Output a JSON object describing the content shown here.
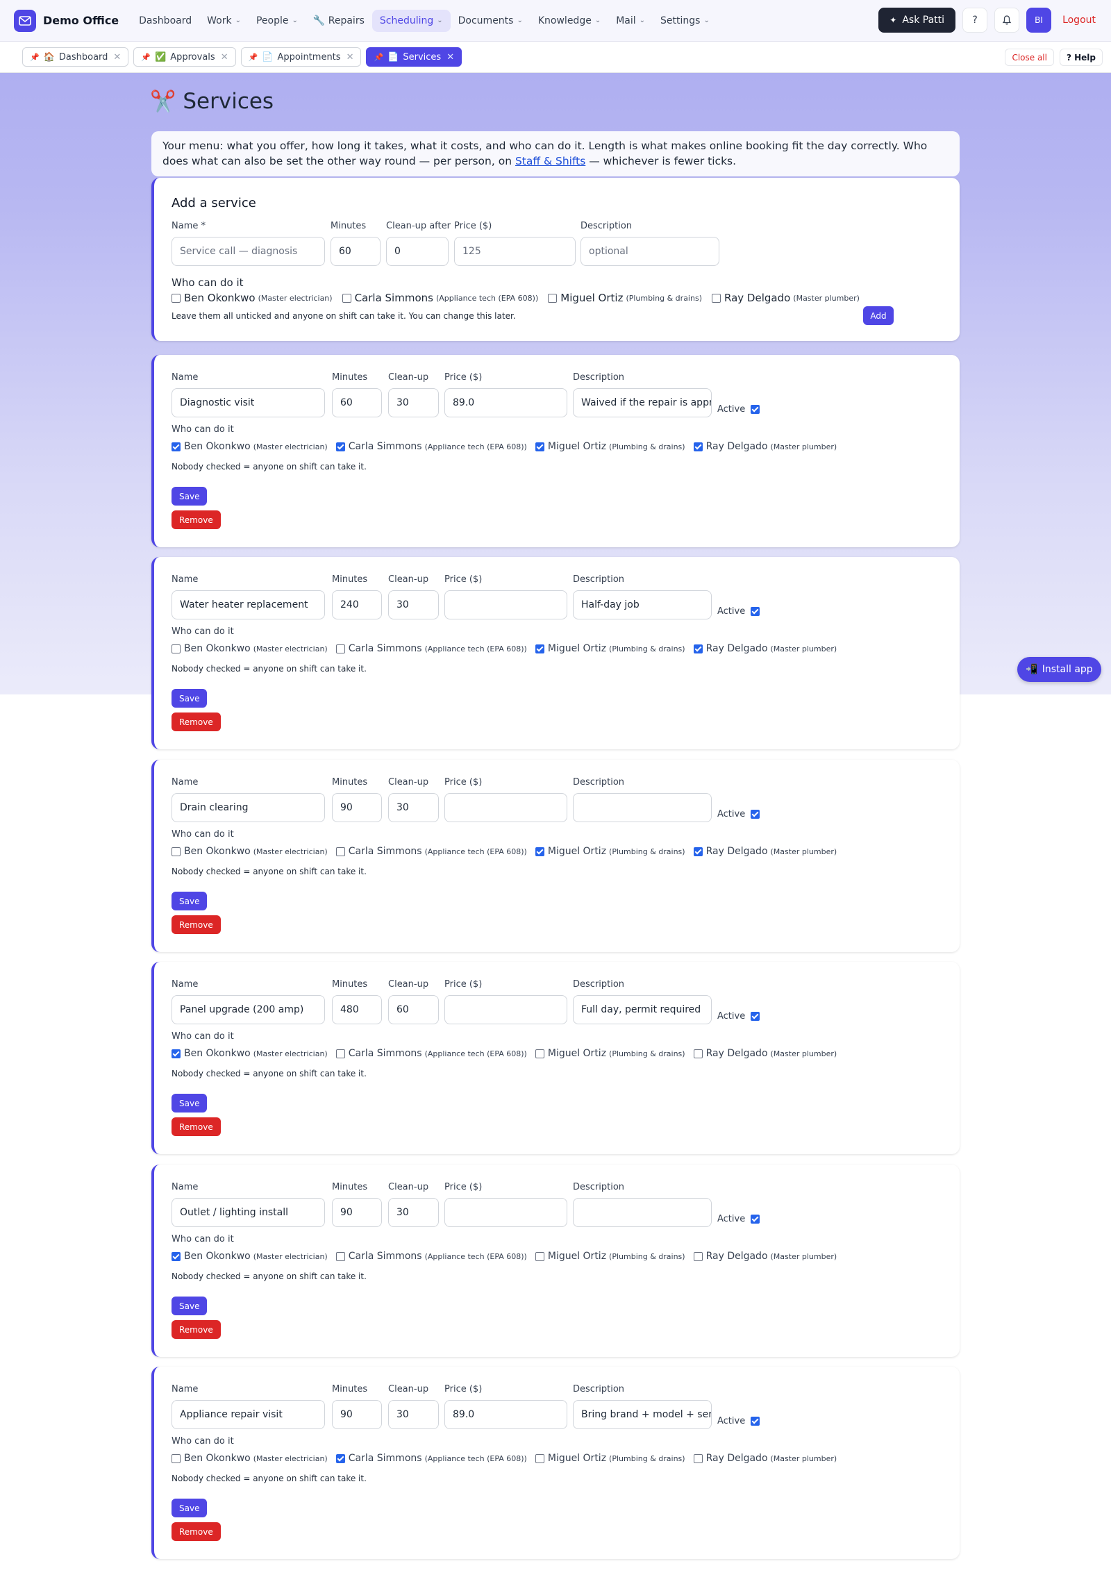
{
  "app": {
    "name": "Demo Office",
    "logo_icon": "mail-icon"
  },
  "nav": [
    {
      "label": "Dashboard",
      "dropdown": false
    },
    {
      "label": "Work",
      "dropdown": true
    },
    {
      "label": "People",
      "dropdown": true
    },
    {
      "label": "🔧 Repairs",
      "dropdown": false
    },
    {
      "label": "Scheduling",
      "dropdown": true,
      "active": true
    },
    {
      "label": "Documents",
      "dropdown": true
    },
    {
      "label": "Knowledge",
      "dropdown": true
    },
    {
      "label": "Mail",
      "dropdown": true
    },
    {
      "label": "Settings",
      "dropdown": true
    }
  ],
  "topright": {
    "ask_label": "Ask Patti",
    "help_label": "?",
    "avatar_initials": "BI",
    "logout_label": "Logout"
  },
  "tabs": [
    {
      "emoji": "🏠",
      "label": "Dashboard"
    },
    {
      "emoji": "✅",
      "label": "Approvals"
    },
    {
      "emoji": "📄",
      "label": "Appointments"
    },
    {
      "emoji": "📄",
      "label": "Services",
      "active": true
    }
  ],
  "tabbar": {
    "close_all": "Close all",
    "help": "? Help"
  },
  "page": {
    "title": "Services",
    "title_emoji": "✂️",
    "intro_before": "Your menu: what you offer, how long it takes, what it costs, and who can do it. Length is what makes online booking fit the day correctly. Who does what can also be set the other way round — per person, on ",
    "intro_link": "Staff & Shifts",
    "intro_after": " — whichever is fewer ticks."
  },
  "add_form": {
    "heading": "Add a service",
    "name_label": "Name *",
    "minutes_label": "Minutes",
    "cleanup_label": "Clean-up after",
    "price_label": "Price ($)",
    "desc_label": "Description",
    "name_placeholder": "Service call — diagnosis",
    "minutes_value": "60",
    "cleanup_value": "0",
    "price_placeholder": "125",
    "desc_placeholder": "optional",
    "who_label": "Who can do it",
    "note": "Leave them all unticked and anyone on shift can take it. You can change this later.",
    "add_button": "Add"
  },
  "staff": [
    {
      "name": "Ben Okonkwo",
      "role": "(Master electrician)"
    },
    {
      "name": "Carla Simmons",
      "role": "(Appliance tech (EPA 608))"
    },
    {
      "name": "Miguel Ortiz",
      "role": "(Plumbing & drains)"
    },
    {
      "name": "Ray Delgado",
      "role": "(Master plumber)"
    }
  ],
  "labels": {
    "name": "Name",
    "minutes": "Minutes",
    "cleanup": "Clean-up",
    "price": "Price ($)",
    "description": "Description",
    "active": "Active",
    "who": "Who can do it",
    "note": "Nobody checked = anyone on shift can take it.",
    "save": "Save",
    "remove": "Remove"
  },
  "services": [
    {
      "name": "Diagnostic visit",
      "minutes": "60",
      "cleanup": "30",
      "price": "89.0",
      "description": "Waived if the repair is approved",
      "active": true,
      "staff": [
        true,
        true,
        true,
        true
      ]
    },
    {
      "name": "Water heater replacement",
      "minutes": "240",
      "cleanup": "30",
      "price": "",
      "description": "Half-day job",
      "active": true,
      "staff": [
        false,
        false,
        true,
        true
      ]
    },
    {
      "name": "Drain clearing",
      "minutes": "90",
      "cleanup": "30",
      "price": "",
      "description": "",
      "active": true,
      "staff": [
        false,
        false,
        true,
        true
      ]
    },
    {
      "name": "Panel upgrade (200 amp)",
      "minutes": "480",
      "cleanup": "60",
      "price": "",
      "description": "Full day, permit required",
      "active": true,
      "staff": [
        true,
        false,
        false,
        false
      ]
    },
    {
      "name": "Outlet / lighting install",
      "minutes": "90",
      "cleanup": "30",
      "price": "",
      "description": "",
      "active": true,
      "staff": [
        true,
        false,
        false,
        false
      ]
    },
    {
      "name": "Appliance repair visit",
      "minutes": "90",
      "cleanup": "30",
      "price": "89.0",
      "description": "Bring brand + model + serial",
      "active": true,
      "staff": [
        false,
        true,
        false,
        false
      ]
    }
  ],
  "install": {
    "label": "Install app",
    "icon": "phone-arrow-icon"
  }
}
